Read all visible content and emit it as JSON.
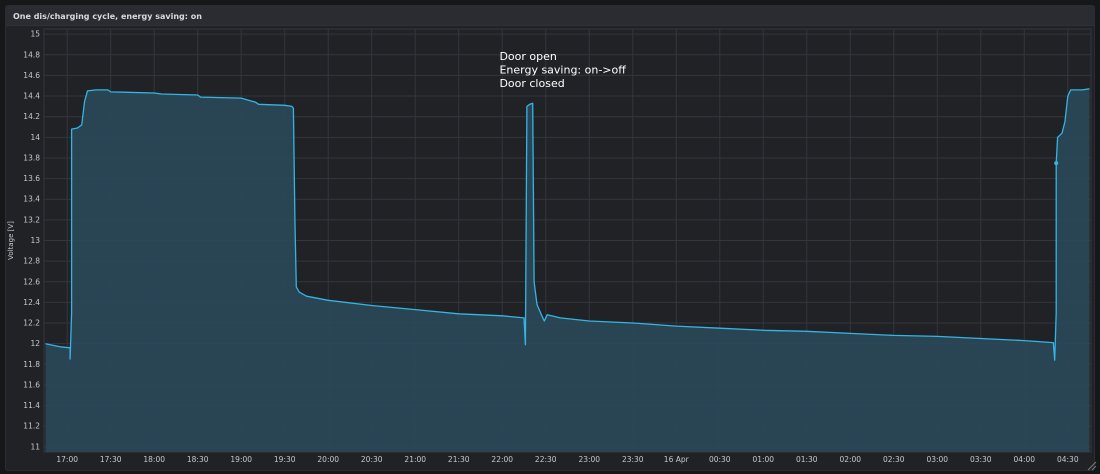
{
  "panel": {
    "title": "One dis/charging cycle, energy saving: on"
  },
  "colors": {
    "line": "#33b5e5",
    "fill": "#2a4a5c",
    "grid": "#34363c",
    "tick_text": "#c7c8ca",
    "annotation_text": "#ffffff"
  },
  "chart_data": {
    "type": "area",
    "title": "One dis/charging cycle, energy saving: on",
    "xlabel": "",
    "ylabel": "Voltage [V]",
    "x_unit": "time (HH:MM)",
    "xlim": [
      "16:44",
      "04:46"
    ],
    "ylim": [
      10.95,
      15.05
    ],
    "grid": true,
    "y_ticks": [
      11,
      11.2,
      11.4,
      11.6,
      11.8,
      12,
      12.2,
      12.4,
      12.6,
      12.8,
      13,
      13.2,
      13.4,
      13.6,
      13.8,
      14,
      14.2,
      14.4,
      14.6,
      14.8,
      15
    ],
    "x_ticks": [
      {
        "t": "17:00",
        "label": "17:00"
      },
      {
        "t": "17:30",
        "label": "17:30"
      },
      {
        "t": "18:00",
        "label": "18:00"
      },
      {
        "t": "18:30",
        "label": "18:30"
      },
      {
        "t": "19:00",
        "label": "19:00"
      },
      {
        "t": "19:30",
        "label": "19:30"
      },
      {
        "t": "20:00",
        "label": "20:00"
      },
      {
        "t": "20:30",
        "label": "20:30"
      },
      {
        "t": "21:00",
        "label": "21:00"
      },
      {
        "t": "21:30",
        "label": "21:30"
      },
      {
        "t": "22:00",
        "label": "22:00"
      },
      {
        "t": "22:30",
        "label": "22:30"
      },
      {
        "t": "23:00",
        "label": "23:00"
      },
      {
        "t": "23:30",
        "label": "23:30"
      },
      {
        "t": "00:00",
        "label": "16 Apr"
      },
      {
        "t": "00:30",
        "label": "00:30"
      },
      {
        "t": "01:00",
        "label": "01:00"
      },
      {
        "t": "01:30",
        "label": "01:30"
      },
      {
        "t": "02:00",
        "label": "02:00"
      },
      {
        "t": "02:30",
        "label": "02:30"
      },
      {
        "t": "03:00",
        "label": "03:00"
      },
      {
        "t": "03:30",
        "label": "03:30"
      },
      {
        "t": "04:00",
        "label": "04:00"
      },
      {
        "t": "04:30",
        "label": "04:30"
      }
    ],
    "series": [
      {
        "points": [
          [
            "16:45",
            12.0
          ],
          [
            "16:55",
            11.97
          ],
          [
            "17:02",
            11.96
          ],
          [
            "17:02",
            11.85
          ],
          [
            "17:03",
            12.3
          ],
          [
            "17:03",
            14.08
          ],
          [
            "17:07",
            14.09
          ],
          [
            "17:10",
            14.12
          ],
          [
            "17:12",
            14.35
          ],
          [
            "17:14",
            14.45
          ],
          [
            "17:20",
            14.46
          ],
          [
            "17:28",
            14.46
          ],
          [
            "17:30",
            14.44
          ],
          [
            "18:00",
            14.43
          ],
          [
            "18:05",
            14.42
          ],
          [
            "18:30",
            14.41
          ],
          [
            "18:32",
            14.39
          ],
          [
            "19:00",
            14.38
          ],
          [
            "19:05",
            14.36
          ],
          [
            "19:10",
            14.34
          ],
          [
            "19:12",
            14.32
          ],
          [
            "19:30",
            14.31
          ],
          [
            "19:35",
            14.3
          ],
          [
            "19:36",
            14.28
          ],
          [
            "19:37",
            13.2
          ],
          [
            "19:38",
            12.55
          ],
          [
            "19:40",
            12.5
          ],
          [
            "19:45",
            12.46
          ],
          [
            "20:00",
            12.42
          ],
          [
            "20:30",
            12.37
          ],
          [
            "21:00",
            12.33
          ],
          [
            "21:30",
            12.29
          ],
          [
            "22:00",
            12.27
          ],
          [
            "22:15",
            12.25
          ],
          [
            "22:16",
            11.99
          ],
          [
            "22:17",
            14.3
          ],
          [
            "22:19",
            14.32
          ],
          [
            "22:21",
            14.33
          ],
          [
            "22:22",
            12.6
          ],
          [
            "22:24",
            12.38
          ],
          [
            "22:27",
            12.28
          ],
          [
            "22:29",
            12.22
          ],
          [
            "22:31",
            12.28
          ],
          [
            "22:40",
            12.25
          ],
          [
            "23:00",
            12.22
          ],
          [
            "23:30",
            12.2
          ],
          [
            "00:00",
            12.17
          ],
          [
            "00:30",
            12.15
          ],
          [
            "01:00",
            12.13
          ],
          [
            "01:30",
            12.12
          ],
          [
            "02:00",
            12.1
          ],
          [
            "02:30",
            12.08
          ],
          [
            "03:00",
            12.07
          ],
          [
            "03:30",
            12.05
          ],
          [
            "04:00",
            12.03
          ],
          [
            "04:20",
            12.01
          ],
          [
            "04:21",
            11.84
          ],
          [
            "04:22",
            12.3
          ],
          [
            "04:22",
            13.75
          ],
          [
            "04:23",
            14.0
          ],
          [
            "04:26",
            14.04
          ],
          [
            "04:28",
            14.15
          ],
          [
            "04:30",
            14.4
          ],
          [
            "04:32",
            14.46
          ],
          [
            "04:40",
            14.46
          ],
          [
            "04:45",
            14.47
          ]
        ]
      }
    ],
    "markers": [
      {
        "t": "04:22",
        "v": 13.75
      }
    ],
    "annotation": {
      "t": "22:16",
      "v": 14.75,
      "lines": [
        "Door open",
        "Energy saving: on->off",
        "Door closed"
      ]
    }
  }
}
